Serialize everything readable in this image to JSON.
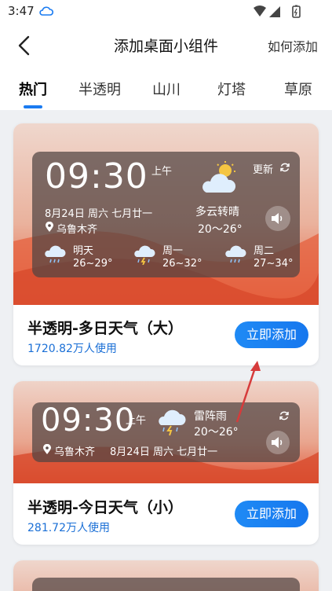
{
  "status_bar": {
    "time": "3:47"
  },
  "header": {
    "title": "添加桌面小组件",
    "help": "如何添加"
  },
  "tabs": [
    {
      "label": "热门",
      "active": true
    },
    {
      "label": "半透明",
      "active": false
    },
    {
      "label": "山川",
      "active": false
    },
    {
      "label": "灯塔",
      "active": false
    },
    {
      "label": "草原",
      "active": false
    }
  ],
  "cards": [
    {
      "title": "半透明-多日天气（大）",
      "usage": "1720.82万人使用",
      "button": "立即添加",
      "widget": {
        "time": "09:30",
        "ampm": "上午",
        "date": "8月24日 周六 七月廿一",
        "location": "乌鲁木齐",
        "refresh": "更新",
        "condition": "多云转晴",
        "temp": "20～26°",
        "forecast": [
          {
            "day": "明天",
            "temp": "26~29°"
          },
          {
            "day": "周一",
            "temp": "26~32°"
          },
          {
            "day": "周二",
            "temp": "27~34°"
          }
        ]
      }
    },
    {
      "title": "半透明-今日天气（小）",
      "usage": "281.72万人使用",
      "button": "立即添加",
      "widget": {
        "time": "09:30",
        "ampm": "上午",
        "condition": "雷阵雨",
        "temp": "20～26°",
        "location": "乌鲁木齐",
        "date": "8月24日 周六 七月廿一"
      }
    },
    {
      "partial": true
    }
  ],
  "colors": {
    "accent": "#1a7bf1",
    "usage_text": "#1a6fd6",
    "annotation_arrow": "#d63b3b"
  }
}
